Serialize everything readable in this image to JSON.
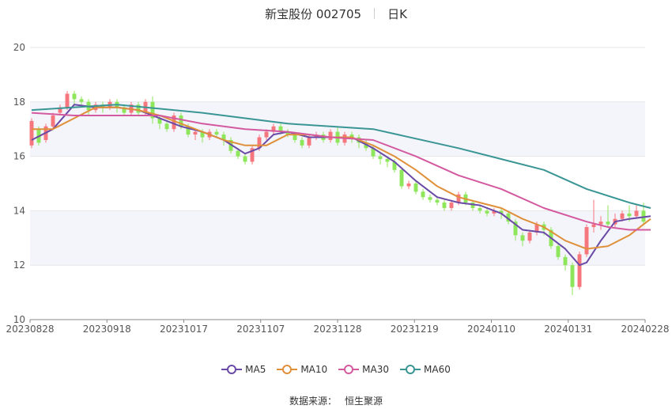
{
  "title": {
    "name": "新宝股份 002705",
    "period": "日K"
  },
  "source": {
    "label": "数据来源：",
    "value": "恒生聚源"
  },
  "colors": {
    "up": "#f5767c",
    "down": "#8ee65a",
    "MA5": "#6a4aa6",
    "MA10": "#e0903a",
    "MA30": "#d45aa0",
    "MA60": "#3a9595",
    "band": "#f3f5fb",
    "grid": "#e6e6e6"
  },
  "chart_data": {
    "type": "candlestick",
    "ylim": [
      10,
      20
    ],
    "yticks": [
      "10",
      "12",
      "14",
      "16",
      "18",
      "20"
    ],
    "xticks": [
      "20230828",
      "20230918",
      "20231017",
      "20231107",
      "20231128",
      "20231219",
      "20240110",
      "20240131",
      "20240228"
    ],
    "legend": [
      "MA5",
      "MA10",
      "MA30",
      "MA60"
    ],
    "legend_position": "bottom",
    "ohlc": [
      [
        16.4,
        17.3,
        16.3,
        17.4
      ],
      [
        17.0,
        16.5,
        16.4,
        17.1
      ],
      [
        16.6,
        17.1,
        16.5,
        17.2
      ],
      [
        17.1,
        17.5,
        17.0,
        17.6
      ],
      [
        17.6,
        17.8,
        17.5,
        17.9
      ],
      [
        17.8,
        18.3,
        17.7,
        18.4
      ],
      [
        18.3,
        18.1,
        17.9,
        18.4
      ],
      [
        18.1,
        18.0,
        17.8,
        18.2
      ],
      [
        18.0,
        17.7,
        17.5,
        18.1
      ],
      [
        17.7,
        17.9,
        17.6,
        18.0
      ],
      [
        17.9,
        17.8,
        17.6,
        18.0
      ],
      [
        17.8,
        18.0,
        17.7,
        18.1
      ],
      [
        18.0,
        17.8,
        17.6,
        18.1
      ],
      [
        17.8,
        17.6,
        17.5,
        17.9
      ],
      [
        17.6,
        17.9,
        17.5,
        18.0
      ],
      [
        17.9,
        17.6,
        17.5,
        18.0
      ],
      [
        17.6,
        18.0,
        17.5,
        18.1
      ],
      [
        18.0,
        17.4,
        17.2,
        18.2
      ],
      [
        17.4,
        17.2,
        17.0,
        17.5
      ],
      [
        17.2,
        17.0,
        16.9,
        17.3
      ],
      [
        17.0,
        17.5,
        16.9,
        17.6
      ],
      [
        17.5,
        17.1,
        17.0,
        17.6
      ],
      [
        17.1,
        16.8,
        16.7,
        17.2
      ],
      [
        16.8,
        16.9,
        16.6,
        17.0
      ],
      [
        16.9,
        16.7,
        16.5,
        17.0
      ],
      [
        16.7,
        16.9,
        16.6,
        17.0
      ],
      [
        16.9,
        16.8,
        16.7,
        17.0
      ],
      [
        16.8,
        16.6,
        16.4,
        16.9
      ],
      [
        16.6,
        16.2,
        16.1,
        16.7
      ],
      [
        16.2,
        16.0,
        15.9,
        16.3
      ],
      [
        16.0,
        15.8,
        15.7,
        16.1
      ],
      [
        15.8,
        16.3,
        15.7,
        16.4
      ],
      [
        16.3,
        16.7,
        16.2,
        16.8
      ],
      [
        16.7,
        16.9,
        16.6,
        17.0
      ],
      [
        16.9,
        17.1,
        16.8,
        17.2
      ],
      [
        17.1,
        16.9,
        16.8,
        17.2
      ],
      [
        16.9,
        16.8,
        16.7,
        17.0
      ],
      [
        16.8,
        16.6,
        16.5,
        16.9
      ],
      [
        16.6,
        16.4,
        16.3,
        16.7
      ],
      [
        16.4,
        16.7,
        16.3,
        16.8
      ],
      [
        16.7,
        16.8,
        16.6,
        16.9
      ],
      [
        16.8,
        16.6,
        16.5,
        16.9
      ],
      [
        16.6,
        16.9,
        16.5,
        17.0
      ],
      [
        16.9,
        16.5,
        16.4,
        17.1
      ],
      [
        16.5,
        16.8,
        16.4,
        16.9
      ],
      [
        16.8,
        16.7,
        16.5,
        16.9
      ],
      [
        16.7,
        16.5,
        16.3,
        16.8
      ],
      [
        16.5,
        16.3,
        16.2,
        16.6
      ],
      [
        16.3,
        16.0,
        15.9,
        16.4
      ],
      [
        16.0,
        15.9,
        15.7,
        16.1
      ],
      [
        15.9,
        15.8,
        15.6,
        16.0
      ],
      [
        15.8,
        15.5,
        15.4,
        15.9
      ],
      [
        15.5,
        14.9,
        14.8,
        15.6
      ],
      [
        14.9,
        15.0,
        14.8,
        15.1
      ],
      [
        15.0,
        14.7,
        14.6,
        15.1
      ],
      [
        14.7,
        14.5,
        14.4,
        14.8
      ],
      [
        14.5,
        14.4,
        14.3,
        14.6
      ],
      [
        14.4,
        14.3,
        14.2,
        14.5
      ],
      [
        14.3,
        14.1,
        14.0,
        14.4
      ],
      [
        14.1,
        14.3,
        14.0,
        14.4
      ],
      [
        14.3,
        14.6,
        14.2,
        14.7
      ],
      [
        14.6,
        14.3,
        14.2,
        14.7
      ],
      [
        14.3,
        14.1,
        14.0,
        14.4
      ],
      [
        14.1,
        14.0,
        13.9,
        14.2
      ],
      [
        14.0,
        13.9,
        13.8,
        14.1
      ],
      [
        13.9,
        14.0,
        13.8,
        14.1
      ],
      [
        14.0,
        13.9,
        13.7,
        14.1
      ],
      [
        13.9,
        13.6,
        13.5,
        14.0
      ],
      [
        13.6,
        13.1,
        12.9,
        13.7
      ],
      [
        13.1,
        12.9,
        12.7,
        13.2
      ],
      [
        12.9,
        13.2,
        12.8,
        13.3
      ],
      [
        13.2,
        13.5,
        13.1,
        13.6
      ],
      [
        13.5,
        13.3,
        13.1,
        13.6
      ],
      [
        13.3,
        12.7,
        12.6,
        13.4
      ],
      [
        12.7,
        12.3,
        12.2,
        12.8
      ],
      [
        12.3,
        12.0,
        11.8,
        12.4
      ],
      [
        12.0,
        11.2,
        10.9,
        12.1
      ],
      [
        11.2,
        12.4,
        11.1,
        12.5
      ],
      [
        12.4,
        13.4,
        12.3,
        13.5
      ],
      [
        13.4,
        13.5,
        13.2,
        14.4
      ],
      [
        13.5,
        13.6,
        13.3,
        13.8
      ],
      [
        13.6,
        13.5,
        13.4,
        14.2
      ],
      [
        13.5,
        13.7,
        13.4,
        13.9
      ],
      [
        13.7,
        13.9,
        13.6,
        14.0
      ],
      [
        13.9,
        13.8,
        13.6,
        14.2
      ],
      [
        13.8,
        14.0,
        13.7,
        14.2
      ],
      [
        14.0,
        13.6,
        13.5,
        14.3
      ]
    ],
    "ma": {
      "MA5": [
        [
          0,
          16.6
        ],
        [
          3,
          17.0
        ],
        [
          6,
          17.9
        ],
        [
          9,
          17.8
        ],
        [
          12,
          17.8
        ],
        [
          15,
          17.7
        ],
        [
          18,
          17.4
        ],
        [
          21,
          17.1
        ],
        [
          24,
          16.9
        ],
        [
          27,
          16.6
        ],
        [
          30,
          16.1
        ],
        [
          32,
          16.3
        ],
        [
          34,
          16.8
        ],
        [
          36,
          16.9
        ],
        [
          39,
          16.7
        ],
        [
          42,
          16.7
        ],
        [
          45,
          16.7
        ],
        [
          48,
          16.3
        ],
        [
          51,
          15.8
        ],
        [
          54,
          15.1
        ],
        [
          57,
          14.5
        ],
        [
          60,
          14.3
        ],
        [
          63,
          14.2
        ],
        [
          66,
          13.9
        ],
        [
          69,
          13.3
        ],
        [
          72,
          13.2
        ],
        [
          75,
          12.6
        ],
        [
          77,
          12.0
        ],
        [
          78,
          12.1
        ],
        [
          80,
          12.9
        ],
        [
          82,
          13.6
        ],
        [
          84,
          13.7
        ],
        [
          87,
          13.8
        ]
      ],
      "MA10": [
        [
          0,
          17.0
        ],
        [
          3,
          17.0
        ],
        [
          6,
          17.4
        ],
        [
          9,
          17.8
        ],
        [
          12,
          17.8
        ],
        [
          15,
          17.7
        ],
        [
          18,
          17.5
        ],
        [
          21,
          17.2
        ],
        [
          24,
          16.9
        ],
        [
          27,
          16.6
        ],
        [
          30,
          16.4
        ],
        [
          33,
          16.4
        ],
        [
          36,
          16.8
        ],
        [
          39,
          16.8
        ],
        [
          42,
          16.7
        ],
        [
          45,
          16.7
        ],
        [
          48,
          16.4
        ],
        [
          51,
          16.0
        ],
        [
          54,
          15.5
        ],
        [
          57,
          14.9
        ],
        [
          60,
          14.5
        ],
        [
          63,
          14.3
        ],
        [
          66,
          14.1
        ],
        [
          69,
          13.7
        ],
        [
          72,
          13.4
        ],
        [
          75,
          12.9
        ],
        [
          78,
          12.6
        ],
        [
          81,
          12.7
        ],
        [
          84,
          13.1
        ],
        [
          87,
          13.7
        ]
      ],
      "MA30": [
        [
          0,
          17.6
        ],
        [
          6,
          17.5
        ],
        [
          12,
          17.5
        ],
        [
          18,
          17.5
        ],
        [
          24,
          17.2
        ],
        [
          30,
          17.0
        ],
        [
          36,
          16.9
        ],
        [
          42,
          16.7
        ],
        [
          48,
          16.6
        ],
        [
          54,
          16.0
        ],
        [
          60,
          15.3
        ],
        [
          66,
          14.8
        ],
        [
          72,
          14.1
        ],
        [
          78,
          13.6
        ],
        [
          81,
          13.4
        ],
        [
          84,
          13.3
        ],
        [
          87,
          13.3
        ]
      ],
      "MA60": [
        [
          0,
          17.7
        ],
        [
          12,
          17.9
        ],
        [
          24,
          17.6
        ],
        [
          36,
          17.2
        ],
        [
          48,
          17.0
        ],
        [
          60,
          16.3
        ],
        [
          72,
          15.5
        ],
        [
          78,
          14.8
        ],
        [
          84,
          14.3
        ],
        [
          87,
          14.1
        ]
      ]
    }
  }
}
